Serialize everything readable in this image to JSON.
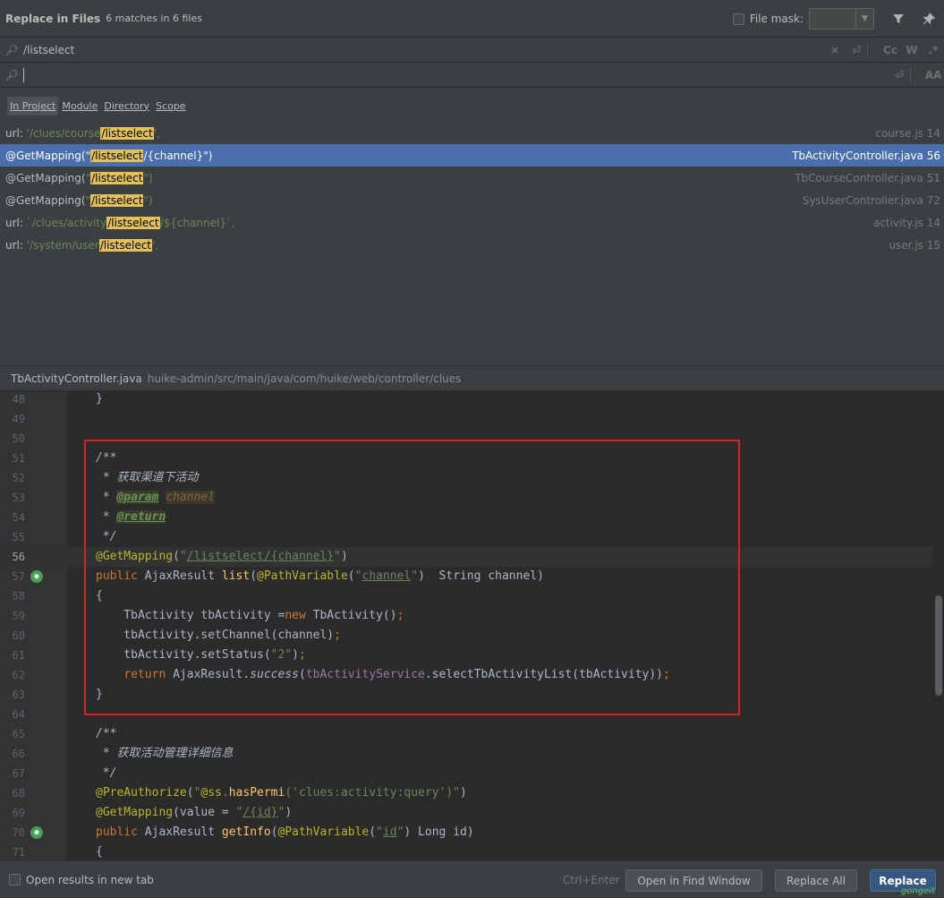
{
  "header": {
    "title": "Replace in Files",
    "matches": "6 matches in 6 files",
    "file_mask_label": "File mask:",
    "filter_icon": "filter-icon",
    "pin_icon": "pin-icon"
  },
  "search": {
    "find_value": "/listselect",
    "replace_value": "",
    "tools_find": [
      "×",
      "⏎",
      "Cc",
      "W",
      ".*"
    ],
    "tools_replace": [
      "⏎",
      "A̷A"
    ]
  },
  "scopes": [
    "In Project",
    "Module",
    "Directory",
    "Scope"
  ],
  "results": [
    {
      "before": "url: ",
      "str_before": "'/clues/course",
      "match": "/listselect",
      "str_after": "',",
      "after": "",
      "file": "course.js 14",
      "selected": false
    },
    {
      "before": "@GetMapping(",
      "str_before": "\"",
      "match": "/listselect",
      "str_after": "/{channel}\")",
      "after": "",
      "file": "TbActivityController.java 56",
      "selected": true
    },
    {
      "before": "@GetMapping(",
      "str_before": "\"",
      "match": "/listselect",
      "str_after": "\")",
      "after": "",
      "file": "TbCourseController.java 51",
      "selected": false
    },
    {
      "before": "@GetMapping(",
      "str_before": "\"",
      "match": "/listselect",
      "str_after": "\")",
      "after": "",
      "file": "SysUserController.java 72",
      "selected": false
    },
    {
      "before": "url: ",
      "str_before": "`/clues/activity",
      "match": "/listselect",
      "str_after": "/${channel}`,",
      "after": "",
      "file": "activity.js 14",
      "selected": false
    },
    {
      "before": "url: ",
      "str_before": "'/system/user",
      "match": "/listselect",
      "str_after": "',",
      "after": "",
      "file": "user.js 15",
      "selected": false
    }
  ],
  "preview": {
    "file_name": "TbActivityController.java",
    "file_path": "huike-admin/src/main/java/com/huike/web/controller/clues",
    "line_numbers": [
      "48",
      "49",
      "50",
      "51",
      "52",
      "53",
      "54",
      "55",
      "56",
      "57",
      "58",
      "59",
      "60",
      "61",
      "62",
      "63",
      "64",
      "65",
      "66",
      "67",
      "68",
      "69",
      "70",
      "71"
    ]
  },
  "footer": {
    "open_new_tab": "Open results in new tab",
    "shortcut": "Ctrl+Enter",
    "open_find_window": "Open in Find Window",
    "replace_all": "Replace All",
    "replace": "Replace",
    "watermark": "gongeit"
  },
  "colors": {
    "selection": "#4b6eaf",
    "highlight": "#e2c05a",
    "redbox": "#e02020",
    "editor_bg": "#2b2b2b",
    "panel_bg": "#3c3f41"
  }
}
